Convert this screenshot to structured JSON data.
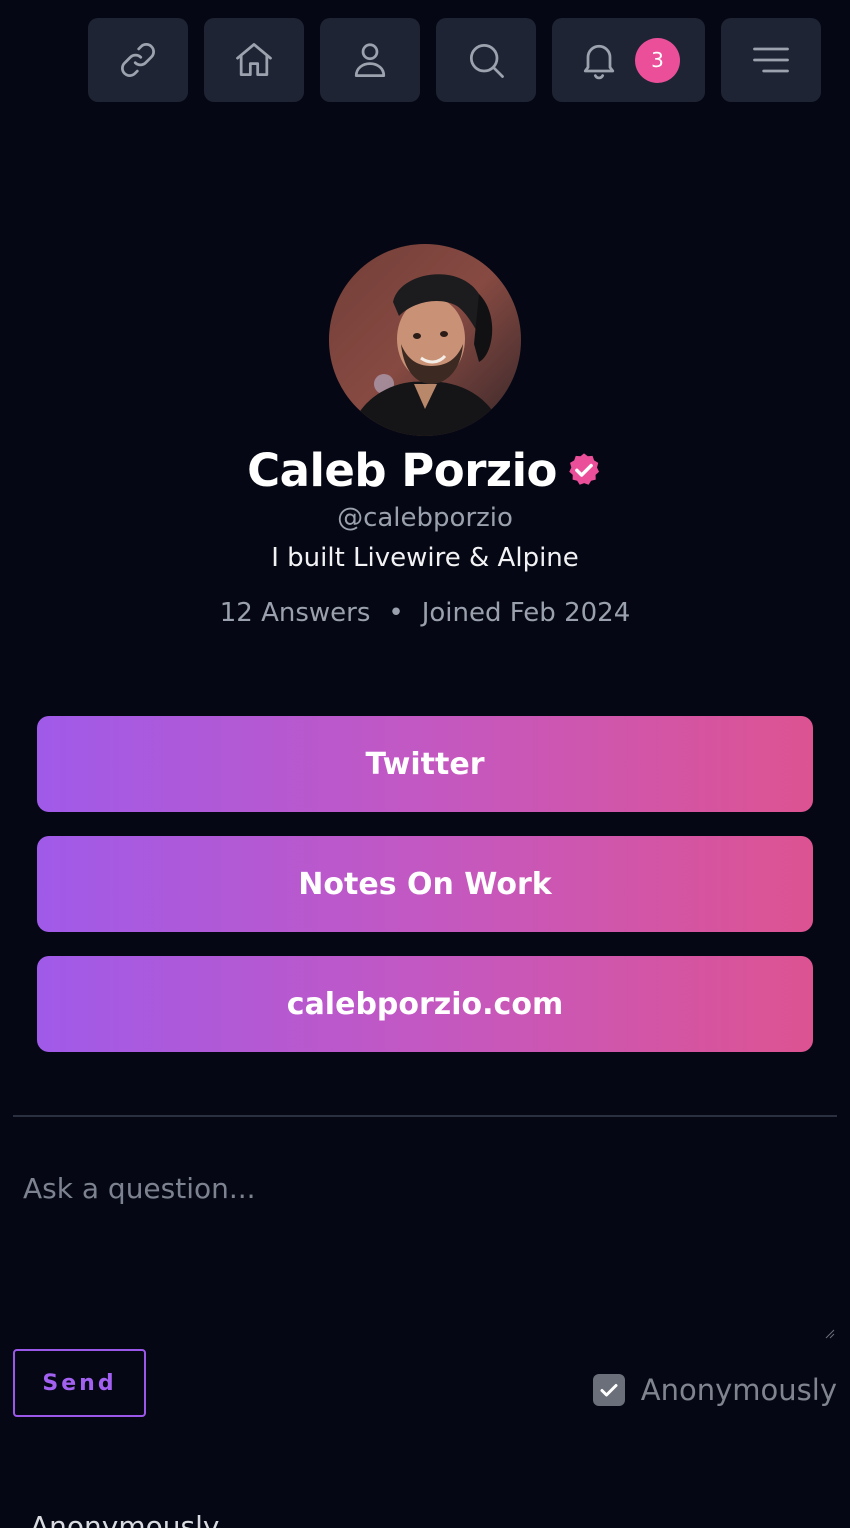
{
  "nav": {
    "icons": [
      "link-icon",
      "home-icon",
      "user-icon",
      "search-icon",
      "bell-icon",
      "menu-icon"
    ],
    "notification_count": "3"
  },
  "profile": {
    "name": "Caleb Porzio",
    "handle": "@calebporzio",
    "bio": "I built Livewire & Alpine",
    "answers": "12 Answers",
    "separator": "•",
    "joined": "Joined Feb 2024",
    "verified_color": "#ec4f9a"
  },
  "links": [
    "Twitter",
    "Notes On Work",
    "calebporzio.com"
  ],
  "question_form": {
    "placeholder": "Ask a question...",
    "send_label": "Send",
    "anonymously_label": "Anonymously",
    "anonymously_checked": true
  },
  "feed": {
    "next_item_label": "Anonymously"
  },
  "colors": {
    "background": "#050814",
    "nav_button": "#1e2433",
    "gradient_start": "#a05ae9",
    "gradient_end": "#dd5392",
    "send_border": "#9b57ea"
  }
}
